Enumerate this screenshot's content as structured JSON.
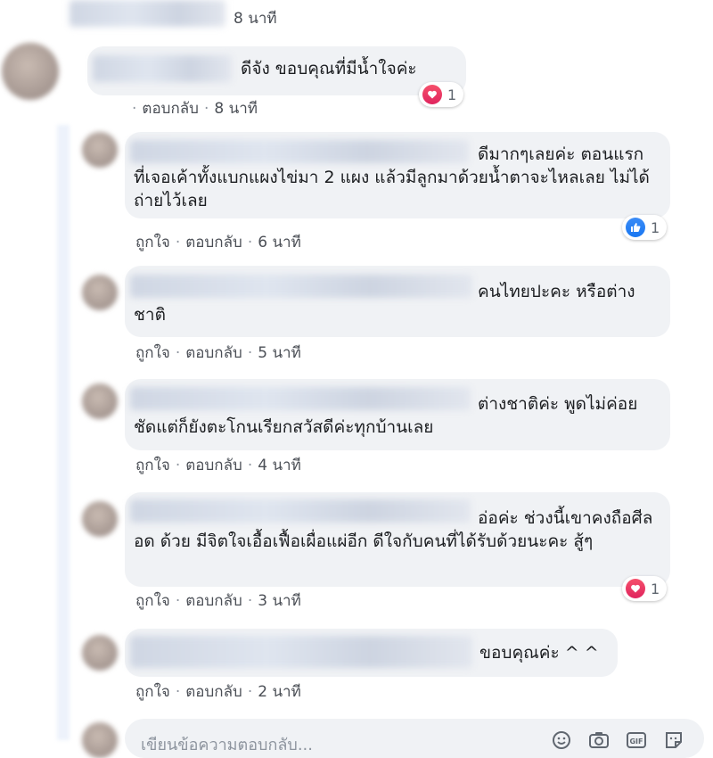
{
  "comments": [
    {
      "text": "",
      "like_label": "",
      "reply_label": "",
      "time": "8 นาที"
    },
    {
      "text": "ดีจัง ขอบคุณที่มีน้ำใจค่ะ",
      "like_label": "",
      "reply_label": "ตอบกลับ",
      "time": "8 นาที",
      "reaction": {
        "icon": "heart-icon",
        "count": "1"
      }
    },
    {
      "text": "ดีมากๆเลยค่ะ ตอนแรกที่เจอเค้าทั้งแบกแผงไข่มา 2 แผง แล้วมีลูกมาด้วยน้ำตาจะไหลเลย ไม่ได้ถ่ายไว้เลย",
      "like_label": "ถูกใจ",
      "reply_label": "ตอบกลับ",
      "time": "6 นาที",
      "reaction": {
        "icon": "thumbs-up-icon",
        "count": "1"
      }
    },
    {
      "text": "คนไทยปะคะ หรือต่างชาติ",
      "like_label": "ถูกใจ",
      "reply_label": "ตอบกลับ",
      "time": "5 นาที"
    },
    {
      "text": "ต่างชาติค่ะ พูดไม่ค่อยชัดแต่ก็ยังตะโกนเรียกสวัสดีค่ะทุกบ้านเลย",
      "like_label": "ถูกใจ",
      "reply_label": "ตอบกลับ",
      "time": "4 นาที"
    },
    {
      "text": "อ่อค่ะ ช่วงนี้เขาคงถือศีล อด ด้วย มีจิตใจเอื้อเฟื้อเผื่อแผ่อีก ดีใจกับคนที่ได้รับด้วยนะคะ สู้ๆ",
      "like_label": "ถูกใจ",
      "reply_label": "ตอบกลับ",
      "time": "3 นาที",
      "reaction": {
        "icon": "heart-icon",
        "count": "1"
      }
    },
    {
      "text": "ขอบคุณค่ะ ^ ^",
      "like_label": "ถูกใจ",
      "reply_label": "ตอบกลับ",
      "time": "2 นาที"
    }
  ],
  "reply_box": {
    "placeholder": "เขียนข้อความตอบกลับ...",
    "icons": [
      "emoji-icon",
      "camera-icon",
      "gif-icon",
      "sticker-icon"
    ]
  },
  "colors": {
    "bubble": "#f0f2f5",
    "meta_text": "#4b4f56",
    "heart": "#e0245e",
    "like": "#1877f2"
  }
}
